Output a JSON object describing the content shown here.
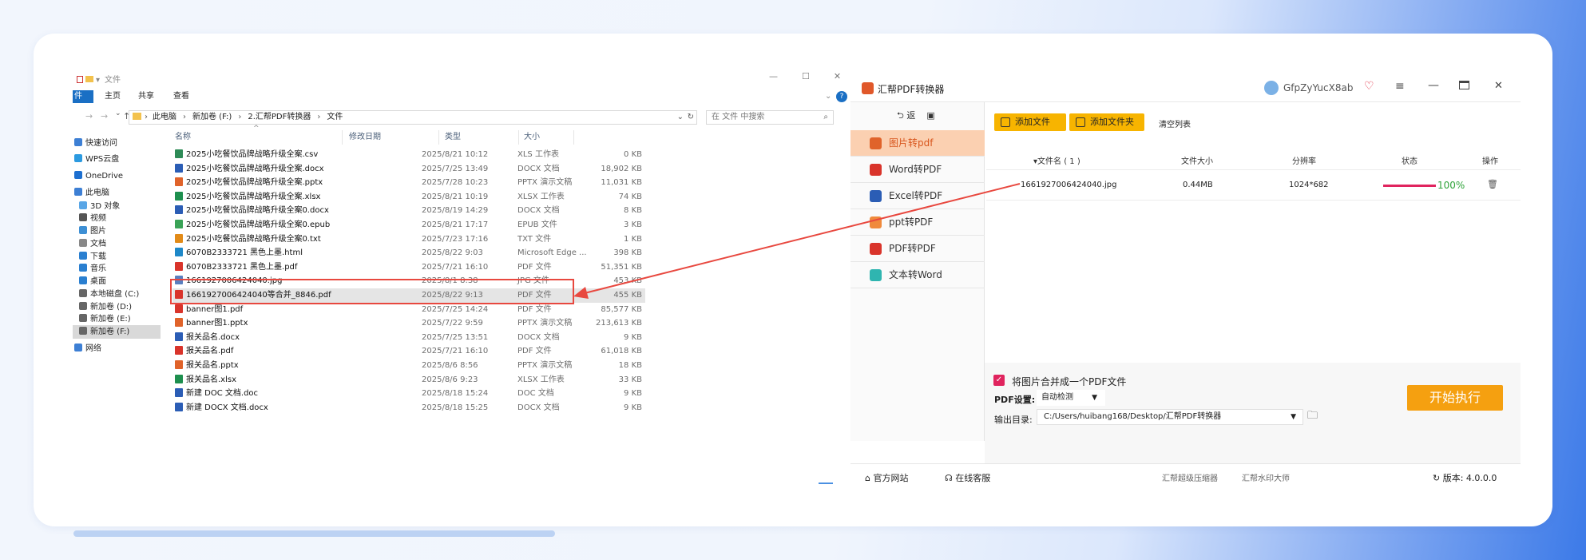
{
  "explorer": {
    "window_title": "文件",
    "tabs": [
      "件",
      "主页",
      "共享",
      "查看"
    ],
    "address_parts": [
      "此电脑",
      "新加卷 (F:)",
      "2.汇帮PDF转换器",
      "文件"
    ],
    "search_placeholder": "在 文件 中搜索",
    "columns": [
      "名称",
      "修改日期",
      "类型",
      "大小"
    ],
    "nav": [
      "快速访问",
      "WPS云盘",
      "OneDrive",
      "此电脑",
      "3D 对象",
      "视频",
      "图片",
      "文档",
      "下载",
      "音乐",
      "桌面",
      "本地磁盘 (C:)",
      "新加卷 (D:)",
      "新加卷 (E:)",
      "新加卷 (F:)",
      "网络"
    ],
    "files": [
      {
        "name": "2025小吃餐饮品牌战略升级全案.csv",
        "date": "2025/8/21 10:12",
        "type": "XLS 工作表",
        "size": "0 KB",
        "icon": "csv-file-icon",
        "color": "#2e8b57"
      },
      {
        "name": "2025小吃餐饮品牌战略升级全案.docx",
        "date": "2025/7/25 13:49",
        "type": "DOCX 文档",
        "size": "18,902 KB",
        "icon": "word-file-icon",
        "color": "#2b5db5"
      },
      {
        "name": "2025小吃餐饮品牌战略升级全案.pptx",
        "date": "2025/7/28 10:23",
        "type": "PPTX 演示文稿",
        "size": "11,031 KB",
        "icon": "ppt-file-icon",
        "color": "#e0632a"
      },
      {
        "name": "2025小吃餐饮品牌战略升级全案.xlsx",
        "date": "2025/8/21 10:19",
        "type": "XLSX 工作表",
        "size": "74 KB",
        "icon": "excel-file-icon",
        "color": "#1d8f4e"
      },
      {
        "name": "2025小吃餐饮品牌战略升级全案0.docx",
        "date": "2025/8/19 14:29",
        "type": "DOCX 文档",
        "size": "8 KB",
        "icon": "word-file-icon",
        "color": "#2b5db5"
      },
      {
        "name": "2025小吃餐饮品牌战略升级全案0.epub",
        "date": "2025/8/21 17:17",
        "type": "EPUB 文件",
        "size": "3 KB",
        "icon": "epub-file-icon",
        "color": "#3aa357"
      },
      {
        "name": "2025小吃餐饮品牌战略升级全案0.txt",
        "date": "2025/7/23 17:16",
        "type": "TXT 文件",
        "size": "1 KB",
        "icon": "txt-file-icon",
        "color": "#e28b18"
      },
      {
        "name": "6070B2333721 黑色上墨.html",
        "date": "2025/8/22 9:03",
        "type": "Microsoft Edge ...",
        "size": "398 KB",
        "icon": "edge-file-icon",
        "color": "#1e88c8"
      },
      {
        "name": "6070B2333721 黑色上墨.pdf",
        "date": "2025/7/21 16:10",
        "type": "PDF 文件",
        "size": "51,351 KB",
        "icon": "pdf-file-icon",
        "color": "#d9342b"
      },
      {
        "name": "1661927006424040.jpg",
        "date": "2025/8/1 8:38",
        "type": "JPG 文件",
        "size": "453 KB",
        "icon": "image-file-icon",
        "color": "#5a7fbf"
      },
      {
        "name": "1661927006424040等合并_8846.pdf",
        "date": "2025/8/22 9:13",
        "type": "PDF 文件",
        "size": "455 KB",
        "icon": "pdf-file-icon",
        "color": "#d9342b"
      },
      {
        "name": "banner图1.pdf",
        "date": "2025/7/25 14:24",
        "type": "PDF 文件",
        "size": "85,577 KB",
        "icon": "pdf-file-icon",
        "color": "#d9342b"
      },
      {
        "name": "banner图1.pptx",
        "date": "2025/7/22 9:59",
        "type": "PPTX 演示文稿",
        "size": "213,613 KB",
        "icon": "ppt-file-icon",
        "color": "#e0632a"
      },
      {
        "name": "报关品名.docx",
        "date": "2025/7/25 13:51",
        "type": "DOCX 文档",
        "size": "9 KB",
        "icon": "word-file-icon",
        "color": "#2b5db5"
      },
      {
        "name": "报关品名.pdf",
        "date": "2025/7/21 16:10",
        "type": "PDF 文件",
        "size": "61,018 KB",
        "icon": "pdf-file-icon",
        "color": "#d9342b"
      },
      {
        "name": "报关品名.pptx",
        "date": "2025/8/6 8:56",
        "type": "PPTX 演示文稿",
        "size": "18 KB",
        "icon": "ppt-file-icon",
        "color": "#e0632a"
      },
      {
        "name": "报关品名.xlsx",
        "date": "2025/8/6 9:23",
        "type": "XLSX 工作表",
        "size": "33 KB",
        "icon": "excel-file-icon",
        "color": "#1d8f4e"
      },
      {
        "name": "新建 DOC 文档.doc",
        "date": "2025/8/18 15:24",
        "type": "DOC 文档",
        "size": "9 KB",
        "icon": "word-file-icon",
        "color": "#2b5db5"
      },
      {
        "name": "新建 DOCX 文档.docx",
        "date": "2025/8/18 15:25",
        "type": "DOCX 文档",
        "size": "9 KB",
        "icon": "word-file-icon",
        "color": "#2b5db5"
      }
    ]
  },
  "converter": {
    "title": "汇帮PDF转换器",
    "username": "GfpZyYucX8ab",
    "back_label": "返",
    "menu": [
      "图片转pdf",
      "Word转PDF",
      "Excel转PDF",
      "ppt转PDF",
      "PDF转PDF",
      "文本转Word"
    ],
    "menu_colors": [
      "#e0632a",
      "#d9342b",
      "#2b5db5",
      "#f08a3c",
      "#d9342b",
      "#2fb5b0"
    ],
    "add_file": "添加文件",
    "add_folder": "添加文件夹",
    "clear_list": "清空列表",
    "table_headers": {
      "name": "文件名 ( 1 )",
      "size": "文件大小",
      "resolution": "分辨率",
      "status": "状态",
      "action": "操作"
    },
    "file_row": {
      "name": "1661927006424040.jpg",
      "size": "0.44MB",
      "resolution": "1024*682",
      "status": "100%",
      "progress": 1.0
    },
    "merge_label": "将图片合并成一个PDF文件",
    "pdf_settings_label": "PDF设置:",
    "pdf_settings_value": "自动检测",
    "output_label": "输出目录:",
    "output_path": "C:/Users/huibang168/Desktop/汇帮PDF转换器",
    "start_button": "开始执行",
    "footer": {
      "website": "官方网站",
      "service": "在线客服",
      "link1": "汇帮超级压缩器",
      "link2": "汇帮水印大师",
      "version": "版本: 4.0.0.0"
    },
    "accent": "#f7b400",
    "start_color": "#f5a010"
  }
}
